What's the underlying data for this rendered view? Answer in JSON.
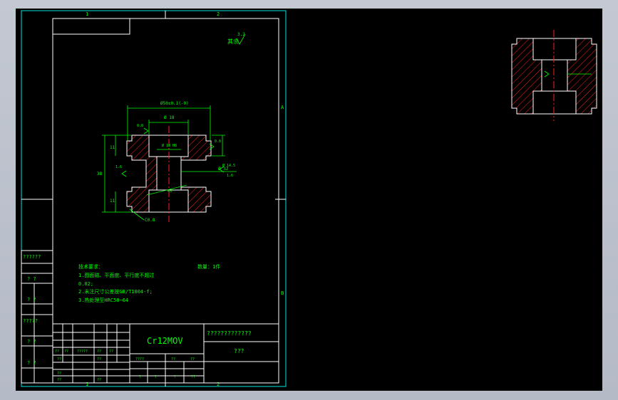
{
  "drawing": {
    "zone_labels_top": [
      "1",
      "2"
    ],
    "zone_labels_bottom": [
      "1",
      "2"
    ],
    "zone_labels_right": [
      "A",
      "B"
    ],
    "roughness": {
      "label": "其余",
      "value": "3.2"
    },
    "dimensions": {
      "top_overall": "Ø50±0.1(-0)",
      "top_inner": "Ø 18",
      "mid_inner": "Ø 18 H8",
      "right_dia": "Ø 32",
      "right_bore": "Ø 14.5",
      "left_height": "38",
      "left_top": "11",
      "left_bottom": "11",
      "chamfer": "C0.8",
      "angle": "45°",
      "rough_a": "0.8",
      "rough_b": "1.6",
      "rough_c": "0.8",
      "rough_d": "1.6"
    },
    "notes": {
      "title": "技术要求：",
      "quantity": "数量：1件",
      "items": [
        "1.图面磁、平面度、平行度不超过",
        "0.02;",
        "2.未注尺寸公差按GB/T1804-f;",
        "3.热处理至HRC58~64"
      ]
    },
    "left_strip": [
      "??????",
      "? ?",
      "? ?",
      "?????",
      "? ?",
      "? ?"
    ],
    "title_block": {
      "material": "Cr12MOV",
      "company": "?????????????",
      "part_name": "???",
      "small_cells_row1": [
        "??",
        "??",
        "?????",
        "??",
        "??"
      ],
      "small_cells_row2": [
        "??",
        "",
        "??",
        ""
      ],
      "small_cells_row3": [
        "??",
        "",
        "",
        "??"
      ],
      "small_cells_row4": [
        "??",
        "",
        "",
        "??"
      ],
      "right_cells_row1": [
        "????",
        "??",
        "??"
      ],
      "right_cells_row2": [
        "?",
        "?",
        "?",
        "??"
      ]
    }
  }
}
